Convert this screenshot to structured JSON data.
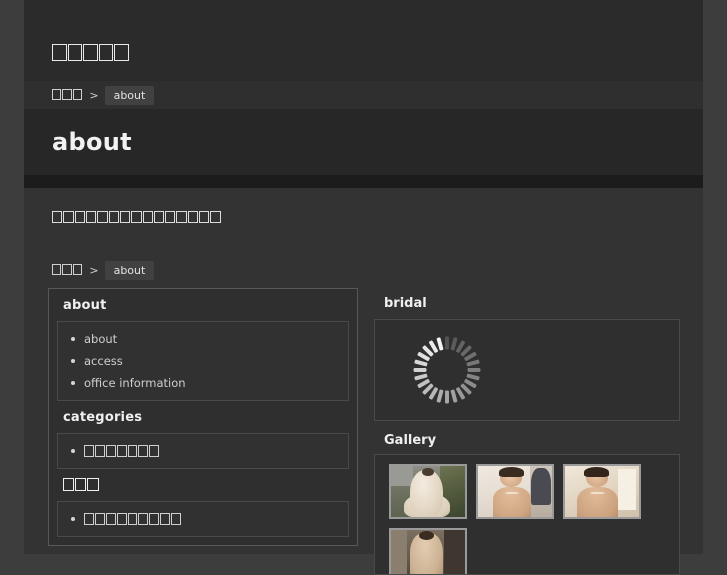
{
  "site": {
    "title_tofu_count": 5,
    "title_note": "unrenderable-cjk-site-title"
  },
  "breadcrumb_top": {
    "home_tofu_count": 3,
    "separator": ">",
    "current": "about"
  },
  "page_title": "about",
  "tagline": {
    "tofu_count": 15,
    "note": "unrenderable-cjk-tagline"
  },
  "breadcrumb_main": {
    "home_tofu_count": 3,
    "separator": ">",
    "current": "about"
  },
  "sidebar": {
    "about": {
      "heading": "about",
      "items": [
        {
          "label": "about"
        },
        {
          "label": "access"
        },
        {
          "label": "office information"
        }
      ]
    },
    "categories": {
      "heading": "categories",
      "items": [
        {
          "tofu_count": 7,
          "note": "unrenderable-cjk-category"
        }
      ]
    },
    "extra": {
      "heading_tofu_count": 3,
      "items": [
        {
          "tofu_count": 9,
          "note": "unrenderable-cjk-link"
        }
      ]
    }
  },
  "right": {
    "bridal": {
      "heading": "bridal",
      "spinner": {
        "name": "loading-spinner",
        "spokes": 24
      }
    },
    "gallery": {
      "heading": "Gallery",
      "thumbnails": [
        {
          "alt": "bride-outdoors-white-dress"
        },
        {
          "alt": "bride-makeup-artist"
        },
        {
          "alt": "bride-portrait-interior"
        },
        {
          "alt": "bride-from-behind"
        }
      ]
    }
  },
  "colors": {
    "body_bg": "#3d3d3d",
    "page_bg": "#333333",
    "header_bg": "#2b2b2b",
    "crumb_bg": "#2f2f2f",
    "title_band_bg": "#272727",
    "title_underbar": "#1c1c1c",
    "panel_border": "#585858",
    "text": "#d8d8d8"
  }
}
